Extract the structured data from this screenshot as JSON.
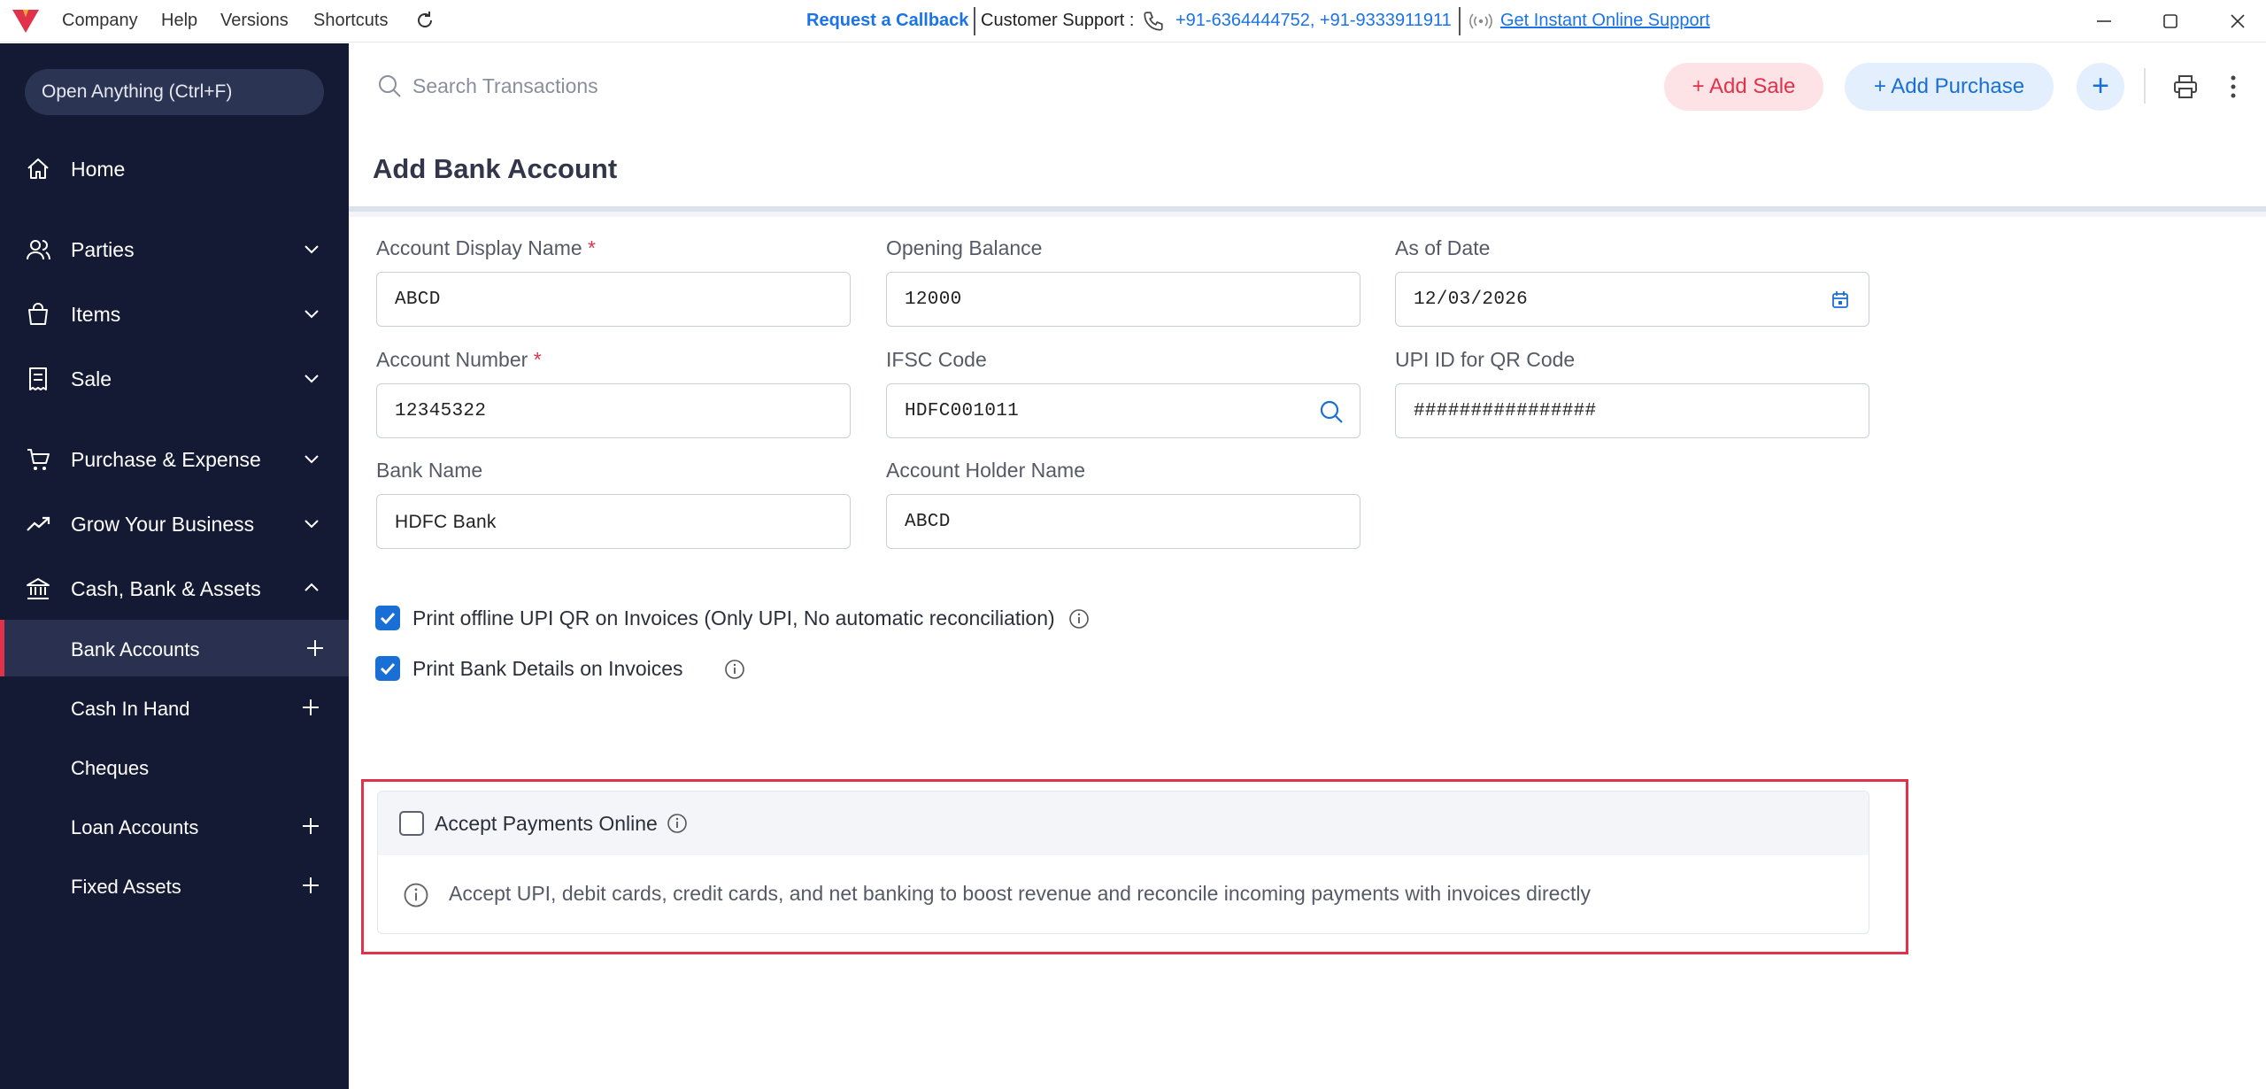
{
  "titlebar": {
    "menu": [
      "Company",
      "Help",
      "Versions",
      "Shortcuts"
    ],
    "request_callback": "Request a Callback",
    "support_label": "Customer Support :",
    "support_phones": "+91-6364444752, +91-9333911911",
    "online_support": "Get Instant Online Support",
    "window_controls": [
      "minimize-icon",
      "maximize-icon",
      "close-icon"
    ]
  },
  "sidebar": {
    "open_anything": "Open Anything (Ctrl+F)",
    "items": [
      {
        "label": "Home",
        "icon": "home-icon"
      },
      {
        "label": "Parties",
        "icon": "users-icon",
        "expandable": true
      },
      {
        "label": "Items",
        "icon": "bag-icon",
        "expandable": true
      },
      {
        "label": "Sale",
        "icon": "receipt-icon",
        "expandable": true
      },
      {
        "label": "Purchase & Expense",
        "icon": "cart-icon",
        "expandable": true
      },
      {
        "label": "Grow Your Business",
        "icon": "trend-icon",
        "expandable": true
      },
      {
        "label": "Cash, Bank & Assets",
        "icon": "bank-icon",
        "expanded": true
      }
    ],
    "subitems": [
      {
        "label": "Bank Accounts",
        "active": true,
        "plus": true
      },
      {
        "label": "Cash In Hand",
        "plus": true
      },
      {
        "label": "Cheques",
        "plus": false
      },
      {
        "label": "Loan Accounts",
        "plus": true
      },
      {
        "label": "Fixed Assets",
        "plus": true
      }
    ]
  },
  "toolbar": {
    "search_placeholder": "Search Transactions",
    "add_sale": "Add Sale",
    "add_purchase": "Add Purchase",
    "plus": "+"
  },
  "page": {
    "title": "Add Bank Account"
  },
  "form": {
    "account_display_name": {
      "label": "Account Display Name",
      "required": "*",
      "value": "ABCD"
    },
    "opening_balance": {
      "label": "Opening Balance",
      "value": "12000"
    },
    "as_of_date": {
      "label": "As of Date",
      "value": "12/03/2026"
    },
    "account_number": {
      "label": "Account Number",
      "required": "*",
      "value": "12345322"
    },
    "ifsc_code": {
      "label": "IFSC Code",
      "value": "HDFC001011"
    },
    "upi_id": {
      "label": "UPI ID for QR Code",
      "value": "################"
    },
    "bank_name": {
      "label": "Bank Name",
      "value": "HDFC Bank"
    },
    "account_holder_name": {
      "label": "Account Holder Name",
      "value": "ABCD"
    }
  },
  "options": {
    "print_upi_qr": {
      "label": "Print offline UPI QR on Invoices (Only UPI, No automatic reconciliation)",
      "checked": true
    },
    "print_bank_details": {
      "label": "Print Bank Details on Invoices",
      "checked": true
    },
    "accept_online": {
      "label": "Accept Payments Online",
      "checked": false
    },
    "accept_online_desc": "Accept UPI, debit cards, credit cards, and net banking to boost revenue and reconcile incoming payments with invoices directly"
  },
  "colors": {
    "sidebar_bg": "#141a33",
    "accent_red": "#e0324a",
    "accent_blue": "#1a6fd6"
  }
}
